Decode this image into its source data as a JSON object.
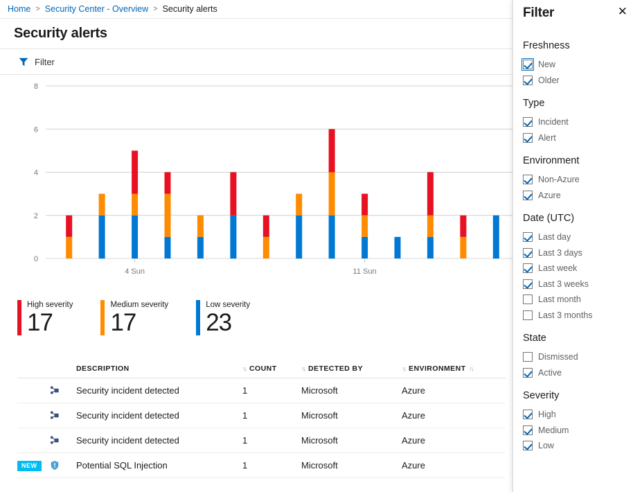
{
  "breadcrumb": {
    "home": "Home",
    "overview": "Security Center - Overview",
    "current": "Security alerts",
    "separator": ">"
  },
  "blade": {
    "title": "Security alerts"
  },
  "toolbar": {
    "filter_label": "Filter",
    "filter_icon": "funnel-icon"
  },
  "chart_data": {
    "type": "bar",
    "title": "",
    "xlabel": "",
    "ylabel": "",
    "ylim": [
      0,
      8
    ],
    "yticks": [
      0,
      2,
      4,
      6,
      8
    ],
    "grid": true,
    "stacked": true,
    "legend_position": "below",
    "xtick_labels": [
      "4 Sun",
      "11 Sun"
    ],
    "xtick_indices": [
      2,
      9
    ],
    "categories": [
      "1",
      "2",
      "3",
      "4",
      "5",
      "6",
      "7",
      "8",
      "9",
      "10",
      "11",
      "12",
      "13",
      "14"
    ],
    "series": [
      {
        "name": "Low severity",
        "color": "#0078d4",
        "values": [
          0,
          2,
          2,
          1,
          1,
          2,
          0,
          2,
          2,
          1,
          1,
          1,
          0,
          2
        ]
      },
      {
        "name": "Medium severity",
        "color": "#ff8c00",
        "values": [
          1,
          1,
          1,
          2,
          1,
          0,
          1,
          1,
          2,
          1,
          0,
          1,
          1,
          0
        ]
      },
      {
        "name": "High severity",
        "color": "#e81123",
        "values": [
          1,
          0,
          2,
          1,
          0,
          2,
          1,
          0,
          2,
          1,
          0,
          2,
          1,
          0
        ]
      }
    ],
    "totals": [
      2,
      3,
      5,
      4,
      2,
      4,
      2,
      3,
      6,
      3,
      1,
      4,
      2,
      2
    ]
  },
  "severity_legend": [
    {
      "label": "High severity",
      "count": "17",
      "color": "#e81123",
      "key": "high"
    },
    {
      "label": "Medium severity",
      "count": "17",
      "color": "#ff8c00",
      "key": "medium"
    },
    {
      "label": "Low severity",
      "count": "23",
      "color": "#0078d4",
      "key": "low"
    }
  ],
  "table": {
    "sort_icon": "sort-arrows-icon",
    "columns": [
      {
        "key": "badge",
        "label": ""
      },
      {
        "key": "icon",
        "label": ""
      },
      {
        "key": "description",
        "label": "DESCRIPTION",
        "sortable": true
      },
      {
        "key": "count",
        "label": "COUNT",
        "sortable": true
      },
      {
        "key": "detected_by",
        "label": "DETECTED BY",
        "sortable": true
      },
      {
        "key": "environment",
        "label": "ENVIRONMENT",
        "sortable": true
      }
    ],
    "rows": [
      {
        "badge": "",
        "icon": "incident-graph-icon",
        "description": "Security incident detected",
        "count": "1",
        "detected_by": "Microsoft",
        "environment": "Azure"
      },
      {
        "badge": "",
        "icon": "incident-graph-icon",
        "description": "Security incident detected",
        "count": "1",
        "detected_by": "Microsoft",
        "environment": "Azure"
      },
      {
        "badge": "",
        "icon": "incident-graph-icon",
        "description": "Security incident detected",
        "count": "1",
        "detected_by": "Microsoft",
        "environment": "Azure"
      },
      {
        "badge": "NEW",
        "icon": "shield-alert-icon",
        "description": "Potential SQL Injection",
        "count": "1",
        "detected_by": "Microsoft",
        "environment": "Azure"
      }
    ]
  },
  "filter_panel": {
    "title": "Filter",
    "close_icon": "close-icon",
    "groups": [
      {
        "title": "Freshness",
        "options": [
          {
            "label": "New",
            "checked": true,
            "focused": true
          },
          {
            "label": "Older",
            "checked": true,
            "focused": false
          }
        ]
      },
      {
        "title": "Type",
        "options": [
          {
            "label": "Incident",
            "checked": true,
            "focused": false
          },
          {
            "label": "Alert",
            "checked": true,
            "focused": false
          }
        ]
      },
      {
        "title": "Environment",
        "options": [
          {
            "label": "Non-Azure",
            "checked": true,
            "focused": false
          },
          {
            "label": "Azure",
            "checked": true,
            "focused": false
          }
        ]
      },
      {
        "title": "Date (UTC)",
        "options": [
          {
            "label": "Last day",
            "checked": true,
            "focused": false
          },
          {
            "label": "Last 3 days",
            "checked": true,
            "focused": false
          },
          {
            "label": "Last week",
            "checked": true,
            "focused": false
          },
          {
            "label": "Last 3 weeks",
            "checked": true,
            "focused": false
          },
          {
            "label": "Last month",
            "checked": false,
            "focused": false
          },
          {
            "label": "Last 3 months",
            "checked": false,
            "focused": false
          }
        ]
      },
      {
        "title": "State",
        "options": [
          {
            "label": "Dismissed",
            "checked": false,
            "focused": false
          },
          {
            "label": "Active",
            "checked": true,
            "focused": false
          }
        ]
      },
      {
        "title": "Severity",
        "options": [
          {
            "label": "High",
            "checked": true,
            "focused": false
          },
          {
            "label": "Medium",
            "checked": true,
            "focused": false
          },
          {
            "label": "Low",
            "checked": true,
            "focused": false
          }
        ]
      }
    ]
  }
}
